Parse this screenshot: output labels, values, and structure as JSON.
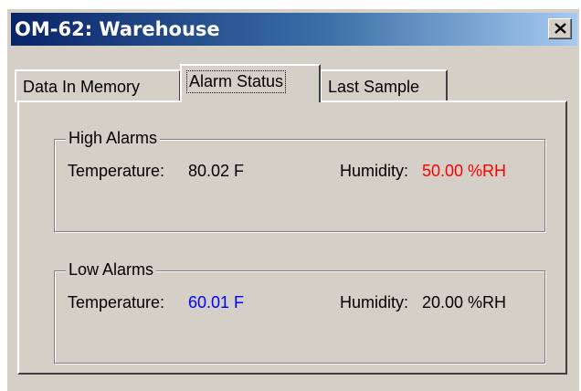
{
  "window": {
    "title": "OM-62: Warehouse",
    "close_icon": "close-icon"
  },
  "tabs": [
    {
      "label": "Data In Memory",
      "selected": false
    },
    {
      "label": "Alarm Status",
      "selected": true
    },
    {
      "label": "Last Sample",
      "selected": false
    }
  ],
  "high_alarms": {
    "legend": "High Alarms",
    "temperature_label": "Temperature:",
    "temperature_value": "80.02 F",
    "humidity_label": "Humidity:",
    "humidity_value": "50.00 %RH",
    "humidity_color": "#ff0000"
  },
  "low_alarms": {
    "legend": "Low Alarms",
    "temperature_label": "Temperature:",
    "temperature_value": "60.01 F",
    "temperature_color": "#0000ff",
    "humidity_label": "Humidity:",
    "humidity_value": "20.00 %RH"
  }
}
